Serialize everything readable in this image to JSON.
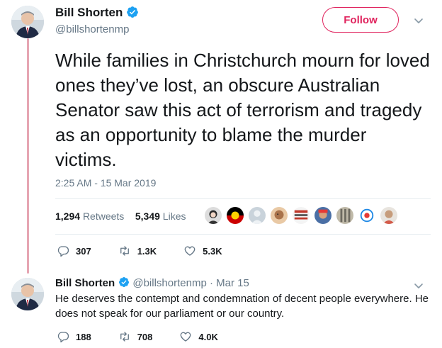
{
  "main_tweet": {
    "author_name": "Bill Shorten",
    "author_handle": "@billshortenmp",
    "follow_label": "Follow",
    "text": "While families in Christchurch mourn for loved ones they’ve lost, an obscure Australian Senator saw this act of terrorism and tragedy as an opportunity to blame the murder victims.",
    "timestamp": "2:25 AM - 15 Mar 2019",
    "retweets_count": "1,294",
    "retweets_label": "Retweets",
    "likes_count": "5,349",
    "likes_label": "Likes",
    "replies": "307",
    "retweets_short": "1.3K",
    "likes_short": "5.3K"
  },
  "reply_tweet": {
    "author_name": "Bill Shorten",
    "author_handle": "@billshortenmp",
    "separator": "·",
    "date": "Mar 15",
    "text": "He deserves the contempt and condemnation of decent people everywhere. He does not speak for our parliament or our country.",
    "replies": "188",
    "retweets": "708",
    "likes": "4.0K"
  },
  "colors": {
    "accent": "#e0245e",
    "verified": "#1da1f2",
    "muted": "#657786",
    "thread_line": "#e6a6b3"
  }
}
